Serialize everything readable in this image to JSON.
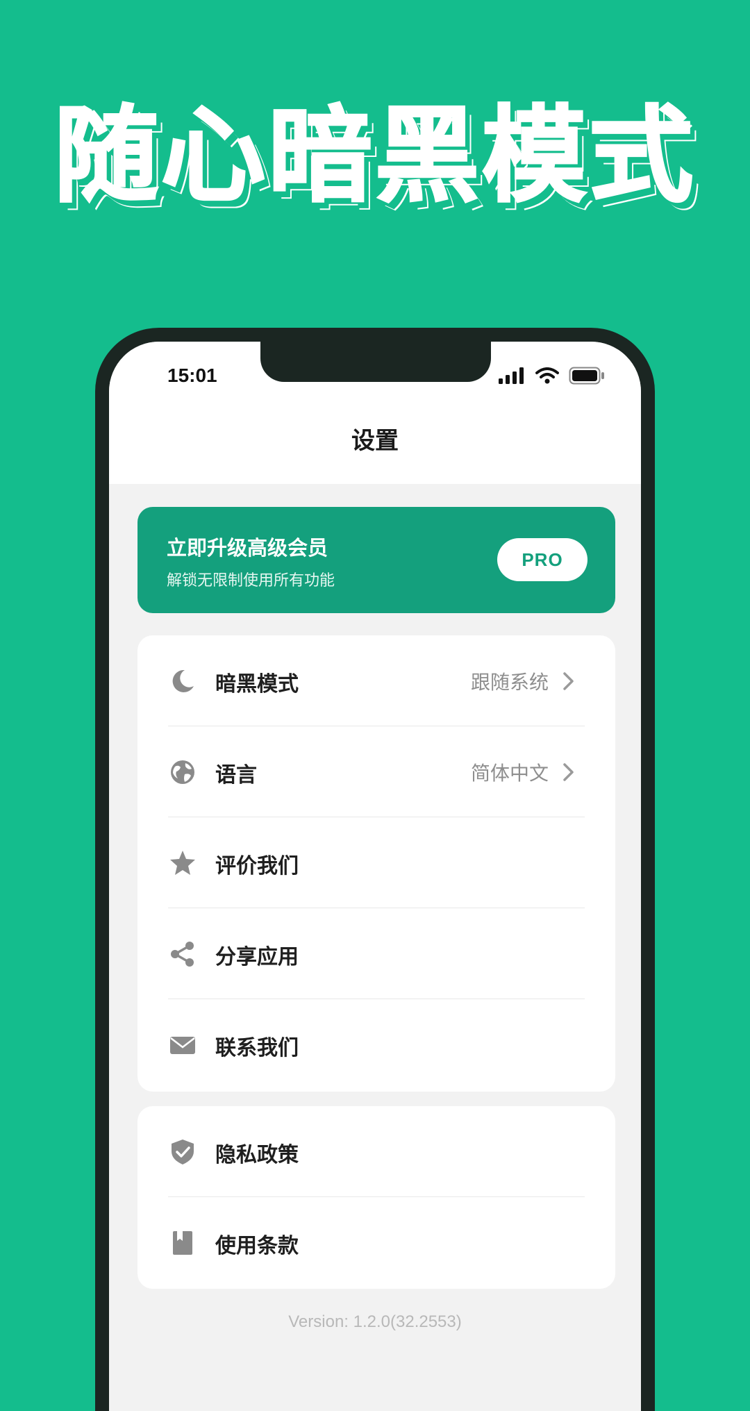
{
  "headline": "随心暗黑模式",
  "status_bar": {
    "time": "15:01",
    "icons": [
      "cellular-signal-icon",
      "wifi-icon",
      "battery-icon"
    ]
  },
  "nav": {
    "title": "设置"
  },
  "pro_banner": {
    "title": "立即升级高级会员",
    "subtitle": "解锁无限制使用所有功能",
    "badge": "PRO"
  },
  "settings_group_1": [
    {
      "label": "暗黑模式",
      "icon": "moon-icon",
      "value": "跟随系统",
      "chevron": true
    },
    {
      "label": "语言",
      "icon": "globe-icon",
      "value": "简体中文",
      "chevron": true
    },
    {
      "label": "评价我们",
      "icon": "star-icon"
    },
    {
      "label": "分享应用",
      "icon": "share-icon"
    },
    {
      "label": "联系我们",
      "icon": "mail-icon"
    }
  ],
  "settings_group_2": [
    {
      "label": "隐私政策",
      "icon": "shield-icon"
    },
    {
      "label": "使用条款",
      "icon": "book-icon"
    }
  ],
  "version": "Version: 1.2.0(32.2553)",
  "colors": {
    "background": "#14bd8d",
    "pro_card": "#14a07d",
    "phone_frame": "#1b2622",
    "icon_gray": "#8a8a8a"
  }
}
